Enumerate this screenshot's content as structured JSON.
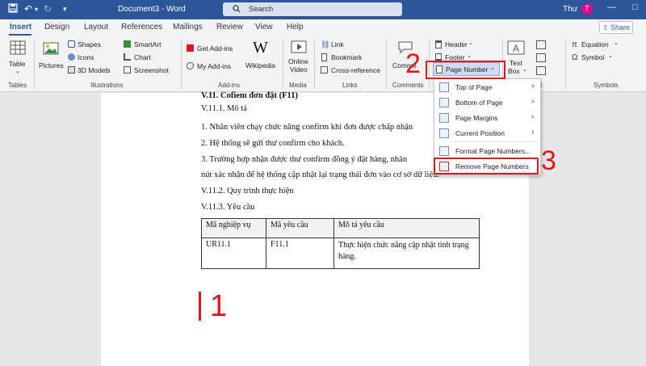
{
  "titlebar": {
    "doc_title": "Document3 - Word",
    "search_label": "Search",
    "user_name": "Thư",
    "avatar_initial": "T"
  },
  "tabs": [
    "Insert",
    "Design",
    "Layout",
    "References",
    "Mailings",
    "Review",
    "View",
    "Help"
  ],
  "share_label": "Share",
  "ribbon": {
    "table": "Table",
    "tables_group": "Tables",
    "pictures": "Pictures",
    "shapes": "Shapes",
    "icons": "Icons",
    "models3d": "3D Models",
    "smartart": "SmartArt",
    "chart": "Chart",
    "screenshot": "Screenshot",
    "illustrations_group": "Illustrations",
    "get_addins": "Get Add-ins",
    "my_addins": "My Add-ins",
    "wikipedia": "Wikipedia",
    "addins_group": "Add-ins",
    "online_video_1": "Online",
    "online_video_2": "Video",
    "media_group": "Media",
    "link": "Link",
    "bookmark": "Bookmark",
    "cross_reference": "Cross-reference",
    "links_group": "Links",
    "comment": "Comme",
    "comments_group": "Comments",
    "header": "Header",
    "footer": "Footer",
    "page_number": "Page Number",
    "text_box_1": "Text",
    "text_box_2": "Box",
    "text_group_tail": "t",
    "equation": "Equation",
    "symbol": "Symbol",
    "symbols_group": "Symbols"
  },
  "document": {
    "heading": "V.11. Cofiem đơn đặt (F11)",
    "sub1": "V.11.1. Mô tả",
    "p1": "1. Nhân viên chạy chức năng confirm khi đơn được chấp nhận",
    "p2": " 2. Hệ thống sẽ gửi thư confirm cho khách.",
    "p3": "3. Trường hợp nhận được thư confirm đồng ý đặt hàng, nhân",
    "p4": "nút xác nhận để hệ thống cập nhật lại trạng thái đơn vào cơ sở dữ liệu.",
    "sub2": "V.11.2. Quy trình thực hiện",
    "sub3": "V.11.3. Yêu cầu",
    "table": {
      "headers": [
        "Mã nghiệp vụ",
        "Mã yêu cầu",
        "Mô tả yêu cầu"
      ],
      "row": [
        "UR11.1",
        "F11.1",
        "Thực hiện chức năng cập nhật tình trạng hàng."
      ]
    }
  },
  "page_number_menu": {
    "items": [
      "Top of Page",
      "Bottom of Page",
      "Page Margins",
      "Current Position",
      "Format Page Numbers...",
      "Remove Page Numbers"
    ]
  },
  "annotations": {
    "step1": "1",
    "step2": "2",
    "step3": "3",
    "color": "#e0161f"
  },
  "colors": {
    "word_blue": "#2b579a",
    "avatar": "#e3008c"
  }
}
